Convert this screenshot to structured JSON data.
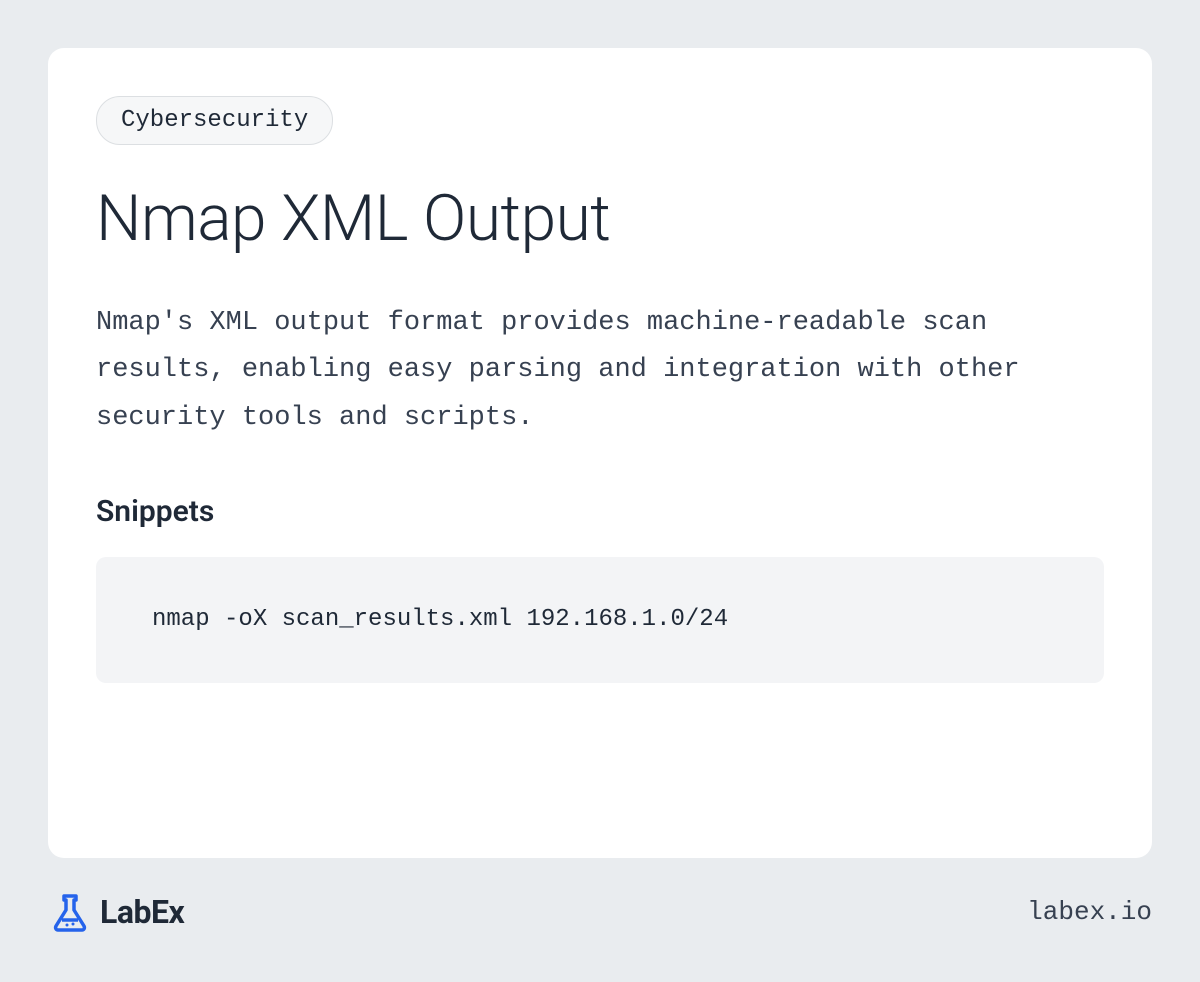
{
  "category": "Cybersecurity",
  "title": "Nmap XML Output",
  "description": "Nmap's XML output format provides machine-readable scan results, enabling easy parsing and integration with other security tools and scripts.",
  "snippets": {
    "heading": "Snippets",
    "code": "nmap -oX scan_results.xml 192.168.1.0/24"
  },
  "footer": {
    "logo_text": "LabEx",
    "site_url": "labex.io"
  }
}
